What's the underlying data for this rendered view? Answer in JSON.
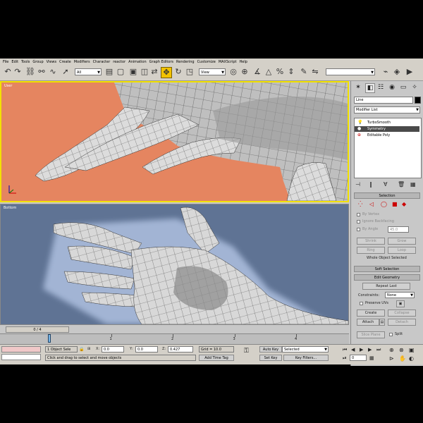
{
  "menu": [
    "File",
    "Edit",
    "Tools",
    "Group",
    "Views",
    "Create",
    "Modifiers",
    "Character",
    "reactor",
    "Animation",
    "Graph Editors",
    "Rendering",
    "Customize",
    "MAXScript",
    "Help"
  ],
  "toolbar": {
    "selection_filter": "All",
    "reference_coord": "View"
  },
  "viewports": {
    "top_label": "User",
    "bottom_label": "Bottom"
  },
  "command_panel": {
    "object_name": "Line",
    "modifier_list_label": "Modifier List",
    "stack": [
      "TurboSmooth",
      "Symmetry",
      "Editable Poly"
    ],
    "selection": {
      "title": "Selection",
      "by_vertex": "By Vertex",
      "ignore_backfacing": "Ignore Backfacing",
      "by_angle": "By Angle",
      "angle_value": "45.0",
      "shrink": "Shrink",
      "grow": "Grow",
      "ring": "Ring",
      "loop": "Loop",
      "status": "Whole Object Selected"
    },
    "soft_selection_title": "Soft Selection",
    "edit_geometry": {
      "title": "Edit Geometry",
      "repeat_last": "Repeat Last",
      "constraints_label": "Constraints:",
      "constraints_value": "None",
      "preserve_uvs": "Preserve UVs",
      "create": "Create",
      "collapse": "Collapse",
      "attach": "Attach",
      "detach": "Detach",
      "slice_plane": "Slice Plane",
      "split": "Split"
    }
  },
  "timeline": {
    "frame_display": "0 / 4",
    "ticks": [
      "0",
      "1",
      "2",
      "3",
      "4"
    ]
  },
  "status": {
    "selection_info": "1 Object Sele",
    "x_label": "X:",
    "x_value": "0.0",
    "y_label": "Y:",
    "y_value": "0.0",
    "z_label": "Z:",
    "z_value": "0.427",
    "grid": "Grid = 10.0",
    "auto_key": "Auto Key",
    "key_mode": "Selected",
    "set_key": "Set Key",
    "key_filters": "Key Filters...",
    "prompt": "Click and drag to select and move objects",
    "add_time_tag": "Add Time Tag",
    "frame_value": "0"
  },
  "colors": {
    "top_viewport_bg": "#e58560",
    "bottom_viewport_bg": "#5f7394",
    "active_border": "#f2e100"
  }
}
